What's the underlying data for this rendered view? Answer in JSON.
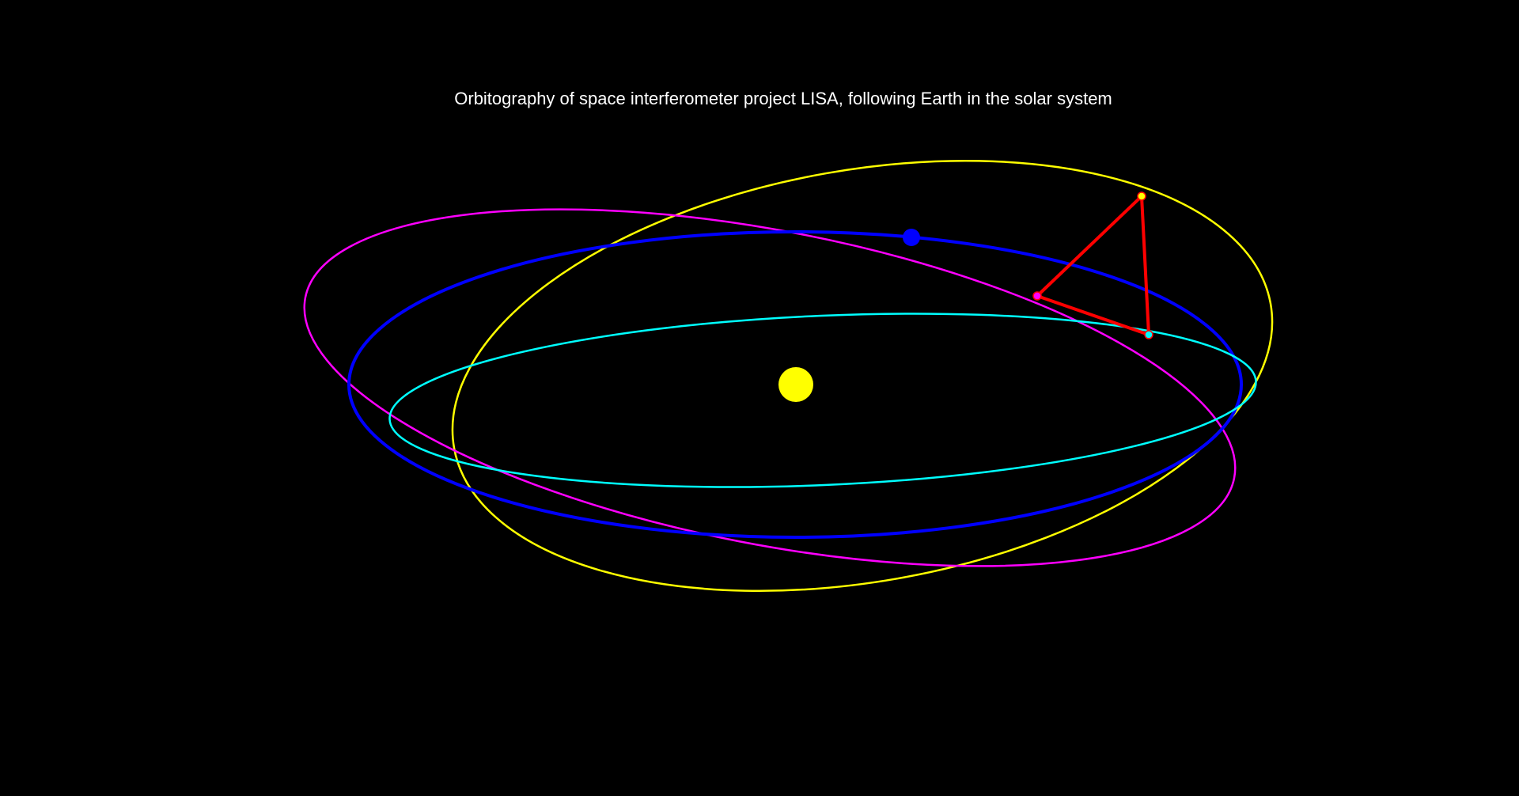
{
  "title": "Orbitography of space interferometer project LISA, following Earth in the solar system",
  "colors": {
    "background": "#000000",
    "title_text": "#ffffff",
    "sun": "#ffff00",
    "earth": "#0000ff",
    "earth_orbit": "#0000ff",
    "spacecraft_1_orbit": "#ffff00",
    "spacecraft_2_orbit": "#ff00ff",
    "spacecraft_3_orbit": "#00ffff",
    "lisa_triangle": "#ff0000"
  },
  "objects": {
    "sun": "sun",
    "earth": "earth",
    "earth_orbit": "earth-orbit",
    "spacecraft": [
      "spacecraft-yellow",
      "spacecraft-magenta",
      "spacecraft-cyan"
    ],
    "spacecraft_orbits": [
      "orbit-yellow",
      "orbit-magenta",
      "orbit-cyan"
    ],
    "constellation": "lisa-triangle"
  }
}
